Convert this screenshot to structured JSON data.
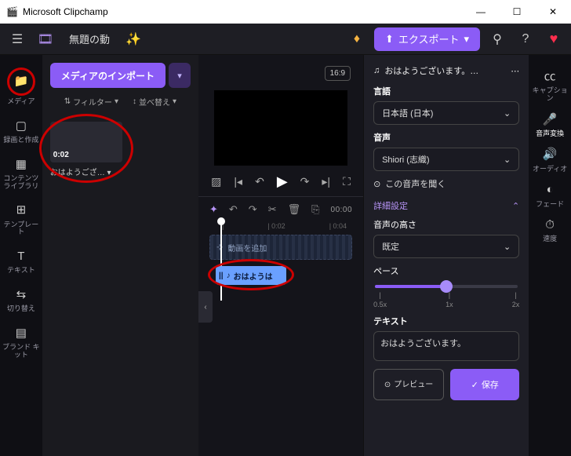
{
  "titlebar": {
    "title": "Microsoft Clipchamp"
  },
  "topbar": {
    "project_name": "無題の動",
    "export_label": "エクスポート"
  },
  "rail": [
    {
      "label": "メディア"
    },
    {
      "label": "録画と作成"
    },
    {
      "label": "コンテンツライブラリ"
    },
    {
      "label": "テンプレート"
    },
    {
      "label": "テキスト"
    },
    {
      "label": "切り替え"
    },
    {
      "label": "ブランド キット"
    }
  ],
  "media": {
    "import_label": "メディアのインポート",
    "filter_label": "フィルター",
    "sort_label": "並べ替え",
    "clip": {
      "duration": "0:02",
      "name": "おはようござ…"
    }
  },
  "center": {
    "ratio": "16:9",
    "time": "00:00",
    "ruler": [
      "|",
      "| 0:02",
      "| 0:04"
    ],
    "add_video_label": "動画を追加",
    "audio_clip_label": "おはようは"
  },
  "props": {
    "title": "おはようございます。…",
    "lang_label": "言語",
    "lang_value": "日本語 (日本)",
    "voice_label": "音声",
    "voice_value": "Shiori (志織)",
    "listen_label": "この音声を聞く",
    "advanced_label": "詳細設定",
    "pitch_label": "音声の高さ",
    "pitch_value": "既定",
    "pace_label": "ペース",
    "pace_ticks": [
      "0.5x",
      "1x",
      "2x"
    ],
    "text_label": "テキスト",
    "text_value": "おはようございます。",
    "preview_label": "プレビュー",
    "save_label": "保存"
  },
  "rail_right": [
    {
      "label": "キャプション"
    },
    {
      "label": "音声変換"
    },
    {
      "label": "オーディオ"
    },
    {
      "label": "フェード"
    },
    {
      "label": "速度"
    }
  ]
}
